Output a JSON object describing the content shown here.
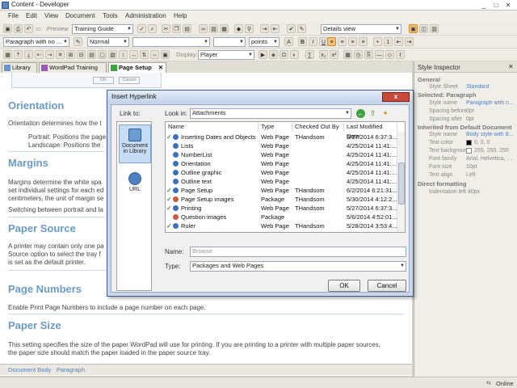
{
  "window": {
    "title": "Content - Developer"
  },
  "menu": [
    "File",
    "Edit",
    "View",
    "Document",
    "Tools",
    "Administration",
    "Help"
  ],
  "toolbar1": {
    "preview_label": "Preview",
    "guide_select": "Training Guide",
    "details_view": "Details view"
  },
  "toolbar2": {
    "paragraph_style": "Paragraph with no ...",
    "char_style": "Normal",
    "size_unit": "points"
  },
  "toolbar3": {
    "display_label": "Display:",
    "display_value": "Player"
  },
  "tabs": [
    "Library",
    "WordPad Training",
    "Page Setup"
  ],
  "document": {
    "sections": [
      {
        "heading": "Orientation",
        "paras": [
          "Orientation determines how the t",
          "Portrait: Positions the page",
          "Landscape: Positions the"
        ]
      },
      {
        "heading": "Margins",
        "paras": [
          "Margins determine the white spa",
          "set individual settings for each ed",
          "centimeters, the unit of margin se",
          "Switching between portrait and la"
        ]
      },
      {
        "heading": "Paper Source",
        "paras": [
          "A printer may contain only one pa",
          "Source option to select the tray f",
          "is set as the default printer."
        ]
      },
      {
        "heading": "Page Numbers",
        "paras": [
          "Enable Print Page Numbers to include a page number on each page."
        ]
      },
      {
        "heading": "Paper Size",
        "paras": [
          "This setting specifies the size of the paper WordPad will use for printing. If you are printing to a printer with multiple paper sources,",
          "the paper size should match the paper loaded in the paper source tray."
        ]
      }
    ],
    "mini_buttons": [
      "OK",
      "Cancel"
    ]
  },
  "statusbar": {
    "left": "Document Body",
    "right": "Paragraph"
  },
  "inspector": {
    "title": "Style Inspector",
    "general_header": "General",
    "style_sheet_label": "Style Sheet",
    "style_sheet_value": "Standard",
    "selected_header": "Selected: Paragraph",
    "rows1": [
      {
        "label": "Style name",
        "value": "Paragraph with n..."
      },
      {
        "label": "Spacing before",
        "value": "0pt"
      },
      {
        "label": "Spacing after",
        "value": "0pt"
      }
    ],
    "inherited_header": "Inherited from Default Document",
    "rows2": [
      {
        "label": "Style name",
        "value": "Body style with 8..."
      },
      {
        "label": "Text color",
        "value": "0, 0, 0"
      },
      {
        "label": "Text backgrour",
        "value": "255, 255, 255"
      },
      {
        "label": "Font family",
        "value": "Arial, Helvetica, ..."
      },
      {
        "label": "Font size",
        "value": "10pt"
      },
      {
        "label": "Text align",
        "value": "Left"
      }
    ],
    "direct_header": "Direct formatting",
    "indent_row": "Indentation left 40px"
  },
  "bottom": {
    "status": "Online"
  },
  "dialog": {
    "title": "Insert Hyperlink",
    "close": "x",
    "link_to": "Link to:",
    "look_in_label": "Look in:",
    "look_in_value": "Attachments",
    "places": [
      "Document in Library",
      "URL"
    ],
    "columns": [
      "Name",
      "Type",
      "Checked Out By",
      "Last Modified Date"
    ],
    "files": [
      {
        "check": true,
        "pkg": false,
        "name": "Inserting Dates and Objects",
        "type": "Web Page",
        "by": "THandsom",
        "date": "5/27/2014 6:37:3..."
      },
      {
        "check": false,
        "pkg": false,
        "name": "Lists",
        "type": "Web Page",
        "by": "",
        "date": "4/25/2014 11:41:..."
      },
      {
        "check": false,
        "pkg": false,
        "name": "NumberList",
        "type": "Web Page",
        "by": "",
        "date": "4/25/2014 11:41:..."
      },
      {
        "check": false,
        "pkg": false,
        "name": "Orientation",
        "type": "Web Page",
        "by": "",
        "date": "4/25/2014 11:41:..."
      },
      {
        "check": false,
        "pkg": false,
        "name": "Outline graphic",
        "type": "Web Page",
        "by": "",
        "date": "4/25/2014 11:41:..."
      },
      {
        "check": false,
        "pkg": false,
        "name": "Outline text",
        "type": "Web Page",
        "by": "",
        "date": "4/25/2014 11:41:..."
      },
      {
        "check": true,
        "pkg": false,
        "name": "Page Setup",
        "type": "Web Page",
        "by": "THandsom",
        "date": "6/2/2014 6:21:31..."
      },
      {
        "check": true,
        "pkg": true,
        "name": "Page Setup images",
        "type": "Package",
        "by": "THandsom",
        "date": "5/30/2014 4:12:2..."
      },
      {
        "check": true,
        "pkg": false,
        "name": "Printing",
        "type": "Web Page",
        "by": "THandsom",
        "date": "5/27/2014 6:37:3..."
      },
      {
        "check": false,
        "pkg": true,
        "name": "Question images",
        "type": "Package",
        "by": "",
        "date": "5/6/2014 4:52:01..."
      },
      {
        "check": true,
        "pkg": false,
        "name": "Ruler",
        "type": "Web Page",
        "by": "THandsom",
        "date": "5/28/2014 3:53:4..."
      }
    ],
    "name_label": "Name:",
    "name_placeholder": "Browse",
    "type_label": "Type:",
    "type_value": "Packages and Web Pages",
    "ok": "OK",
    "cancel": "Cancel"
  }
}
